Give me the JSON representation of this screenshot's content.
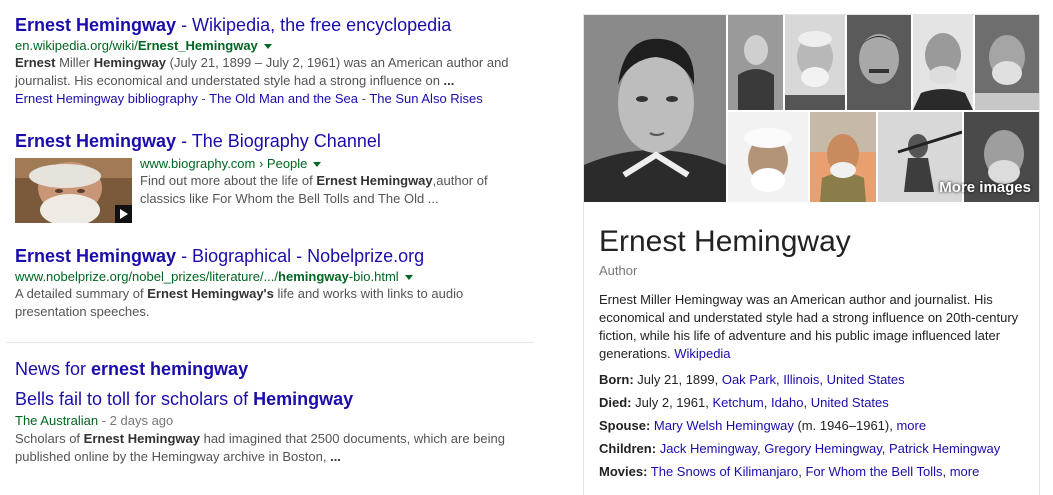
{
  "results": [
    {
      "title_bold": "Ernest Hemingway",
      "title_rest": " - Wikipedia, the free encyclopedia",
      "url_plain": "en.wikipedia.org/wiki/",
      "url_bold": "Ernest_Hemingway",
      "snippet_parts": [
        {
          "b": "Ernest"
        },
        {
          "t": " Miller "
        },
        {
          "b": "Hemingway"
        },
        {
          "t": " (July 21, 1899 – July 2, 1961) was an American author and journalist. His economical and understated style had a strong influence on "
        },
        {
          "b": "..."
        }
      ],
      "sitelinks": [
        "Ernest Hemingway bibliography",
        "The Old Man and the Sea",
        "The Sun Also Rises"
      ]
    },
    {
      "title_bold": "Ernest Hemingway",
      "title_rest": " - The Biography Channel",
      "url_plain": "www.biography.com › People",
      "snippet_parts": [
        {
          "t": "Find out more about the life of "
        },
        {
          "b": "Ernest Hemingway"
        },
        {
          "t": ",author of classics like For Whom the Bell Tolls and The Old ..."
        }
      ],
      "thumb_icon": "video-play-icon"
    },
    {
      "title_bold": "Ernest Hemingway",
      "title_rest": " - Biographical - Nobelprize.org",
      "url_plain": "www.nobelprize.org/nobel_prizes/literature/.../",
      "url_bold": "hemingway",
      "url_tail": "-bio.html",
      "snippet_parts": [
        {
          "t": "A detailed summary of "
        },
        {
          "b": "Ernest Hemingway's"
        },
        {
          "t": " life and works with links to audio presentation speeches."
        }
      ]
    }
  ],
  "news": {
    "heading_plain": "News for ",
    "heading_bold": "ernest hemingway",
    "title_plain": "Bells fail to toll for scholars of ",
    "title_bold": "Hemingway",
    "source": "The Australian",
    "age": " - 2 days ago",
    "snippet_parts": [
      {
        "t": "Scholars of "
      },
      {
        "b": "Ernest Hemingway"
      },
      {
        "t": " had imagined that 2500 documents, which are being published online by the Hemingway archive in Boston, "
      },
      {
        "b": "..."
      }
    ]
  },
  "panel": {
    "more_images": "More images",
    "name": "Ernest Hemingway",
    "subtitle": "Author",
    "description": "Ernest Miller Hemingway was an American author and journalist. His economical and understated style had a strong influence on 20th-century fiction, while his life of adventure and his public image influenced later generations.",
    "description_link": "Wikipedia",
    "facts": [
      {
        "label": "Born:",
        "text": "July 21, 1899, ",
        "links": [
          "Oak Park, Illinois, United States"
        ]
      },
      {
        "label": "Died:",
        "text": "July 2, 1961, ",
        "links": [
          "Ketchum, Idaho, United States"
        ]
      },
      {
        "label": "Spouse:",
        "text": "",
        "links": [
          "Mary Welsh Hemingway"
        ],
        "after": " (m. 1946–1961), ",
        "more": "more"
      },
      {
        "label": "Children:",
        "text": "",
        "links": [
          "Jack Hemingway",
          "Gregory Hemingway",
          "Patrick Hemingway"
        ]
      },
      {
        "label": "Movies:",
        "text": "",
        "links": [
          "The Snows of Kilimanjaro",
          "For Whom the Bell Tolls"
        ],
        "after": ", ",
        "more": "more"
      }
    ]
  }
}
